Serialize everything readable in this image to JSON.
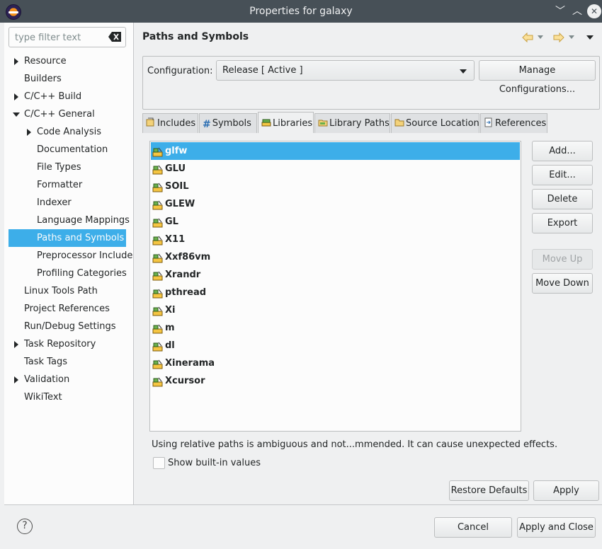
{
  "window": {
    "title": "Properties for galaxy",
    "minimize_glyph": "﹀",
    "maximize_glyph": "︿",
    "close_glyph": "✕"
  },
  "filter": {
    "placeholder": "type filter text",
    "value": ""
  },
  "tree": [
    {
      "label": "Resource",
      "expander": "collapsed",
      "level": 0
    },
    {
      "label": "Builders",
      "expander": "none",
      "level": 0
    },
    {
      "label": "C/C++ Build",
      "expander": "collapsed",
      "level": 0
    },
    {
      "label": "C/C++ General",
      "expander": "expanded",
      "level": 0
    },
    {
      "label": "Code Analysis",
      "expander": "collapsed",
      "level": 1
    },
    {
      "label": "Documentation",
      "expander": "none",
      "level": 1
    },
    {
      "label": "File Types",
      "expander": "none",
      "level": 1
    },
    {
      "label": "Formatter",
      "expander": "none",
      "level": 1
    },
    {
      "label": "Indexer",
      "expander": "none",
      "level": 1
    },
    {
      "label": "Language Mappings",
      "expander": "none",
      "level": 1
    },
    {
      "label": "Paths and Symbols",
      "expander": "none",
      "level": 1,
      "selected": true
    },
    {
      "label": "Preprocessor Include",
      "expander": "none",
      "level": 1
    },
    {
      "label": "Profiling Categories",
      "expander": "none",
      "level": 1
    },
    {
      "label": "Linux Tools Path",
      "expander": "none",
      "level": 0
    },
    {
      "label": "Project References",
      "expander": "none",
      "level": 0
    },
    {
      "label": "Run/Debug Settings",
      "expander": "none",
      "level": 0
    },
    {
      "label": "Task Repository",
      "expander": "collapsed",
      "level": 0
    },
    {
      "label": "Task Tags",
      "expander": "none",
      "level": 0
    },
    {
      "label": "Validation",
      "expander": "collapsed",
      "level": 0
    },
    {
      "label": "WikiText",
      "expander": "none",
      "level": 0
    }
  ],
  "page": {
    "title": "Paths and Symbols",
    "nav": {
      "back_icon": "back-arrow-icon",
      "forward_icon": "forward-arrow-icon"
    }
  },
  "configuration": {
    "label": "Configuration:",
    "selected": "Release  [ Active ]",
    "manage_button": "Manage Configurations..."
  },
  "tabs": [
    {
      "label": "Includes",
      "icon": "includes-icon"
    },
    {
      "label": "Symbols",
      "icon": "hash-icon"
    },
    {
      "label": "Libraries",
      "icon": "library-icon",
      "active": true
    },
    {
      "label": "Library Paths",
      "icon": "library-path-icon"
    },
    {
      "label": "Source Location",
      "icon": "folder-icon"
    },
    {
      "label": "References",
      "icon": "references-icon"
    }
  ],
  "libraries": [
    "glfw",
    "GLU",
    "SOIL",
    "GLEW",
    "GL",
    "X11",
    "Xxf86vm",
    "Xrandr",
    "pthread",
    "Xi",
    "m",
    "dl",
    "Xinerama",
    "Xcursor"
  ],
  "selected_library": "glfw",
  "side_buttons": {
    "add": "Add...",
    "edit": "Edit...",
    "delete": "Delete",
    "export": "Export",
    "move_up": "Move Up",
    "move_down": "Move Down"
  },
  "warning_text": "Using relative paths is ambiguous and not...mmended. It can cause unexpected effects.",
  "show_builtin": {
    "label": "Show built-in values",
    "checked": false
  },
  "page_buttons": {
    "restore_defaults": "Restore Defaults",
    "apply": "Apply"
  },
  "dialog_buttons": {
    "help_glyph": "?",
    "cancel": "Cancel",
    "apply_and_close": "Apply and Close"
  },
  "colors": {
    "selection": "#3daee9",
    "titlebar": "#475057",
    "background": "#eff0f1"
  }
}
